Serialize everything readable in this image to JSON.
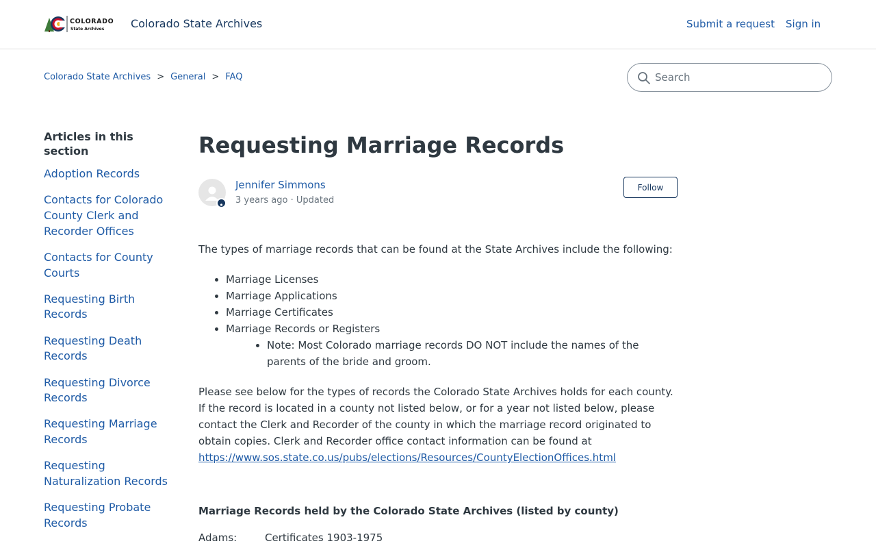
{
  "header": {
    "logo": {
      "word": "COLORADO",
      "sub": "State Archives",
      "colors": {
        "red": "#c8102e",
        "blue": "#17375e",
        "gold": "#f0b323",
        "green": "#3e7b3a"
      }
    },
    "site_title": "Colorado State Archives",
    "submit_request": "Submit a request",
    "sign_in": "Sign in"
  },
  "breadcrumb": [
    {
      "label": "Colorado State Archives"
    },
    {
      "label": "General"
    },
    {
      "label": "FAQ"
    }
  ],
  "breadcrumb_separator": ">",
  "search": {
    "placeholder": "Search",
    "icon": "search-icon"
  },
  "sidebar": {
    "heading": "Articles in this section",
    "items": [
      {
        "label": "Adoption Records"
      },
      {
        "label": "Contacts for Colorado County Clerk and Recorder Offices"
      },
      {
        "label": "Contacts for County Courts"
      },
      {
        "label": "Requesting Birth Records"
      },
      {
        "label": "Requesting Death Records"
      },
      {
        "label": "Requesting Divorce Records"
      },
      {
        "label": "Requesting Marriage Records"
      },
      {
        "label": "Requesting Naturalization Records"
      },
      {
        "label": "Requesting Probate Records"
      }
    ]
  },
  "article": {
    "title": "Requesting Marriage Records",
    "author": {
      "name": "Jennifer Simmons",
      "time": "3 years ago",
      "updated": "Updated",
      "follow_label": "Follow"
    },
    "intro": "The types of marriage records that can be found at the State Archives include the following:",
    "record_types": [
      "Marriage Licenses",
      "Marriage Applications",
      "Marriage Certificates",
      "Marriage Records or Registers"
    ],
    "note": "Note: Most Colorado marriage records DO NOT include the names of the parents of the bride and groom.",
    "paragraph": "Please see below for the types of records the Colorado State Archives holds for each county. If the record is located in a county not listed below, or for a year not listed below, please contact the Clerk and Recorder of the county in which the marriage record originated to obtain copies.  Clerk and Recorder office contact information can be found at",
    "url": "https://www.sos.state.co.us/pubs/elections/Resources/CountyElectionOffices.html",
    "section_heading": "Marriage Records held by the Colorado State Archives (listed by county)",
    "counties": [
      {
        "county": "Adams:",
        "records": "Certificates 1903-1975"
      }
    ]
  }
}
